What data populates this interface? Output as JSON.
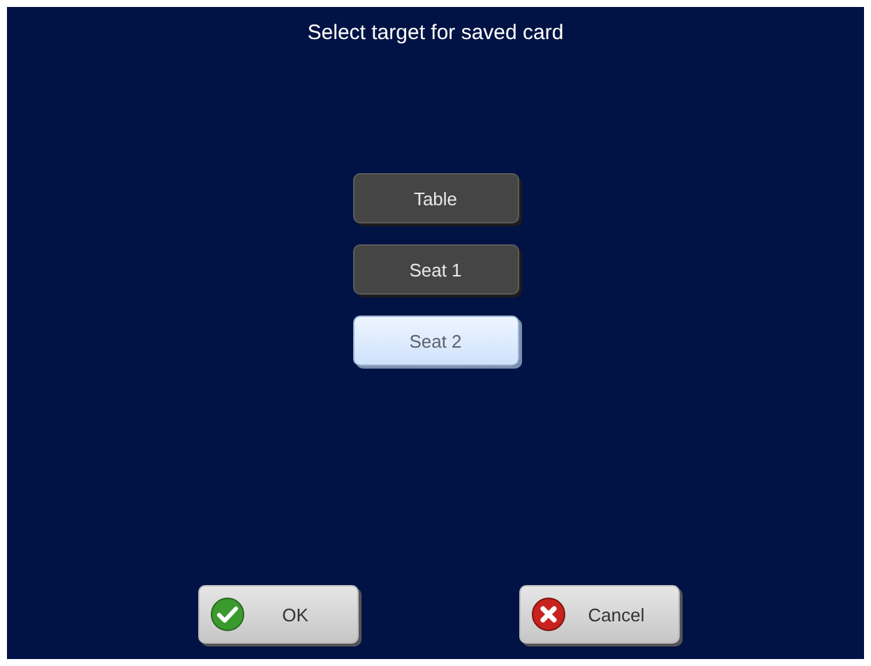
{
  "title": "Select target for saved card",
  "options": [
    {
      "label": "Table",
      "selected": false
    },
    {
      "label": "Seat 1",
      "selected": false
    },
    {
      "label": "Seat 2",
      "selected": true
    }
  ],
  "actions": [
    {
      "kind": "ok",
      "label": "OK"
    },
    {
      "kind": "cancel",
      "label": "Cancel"
    }
  ]
}
